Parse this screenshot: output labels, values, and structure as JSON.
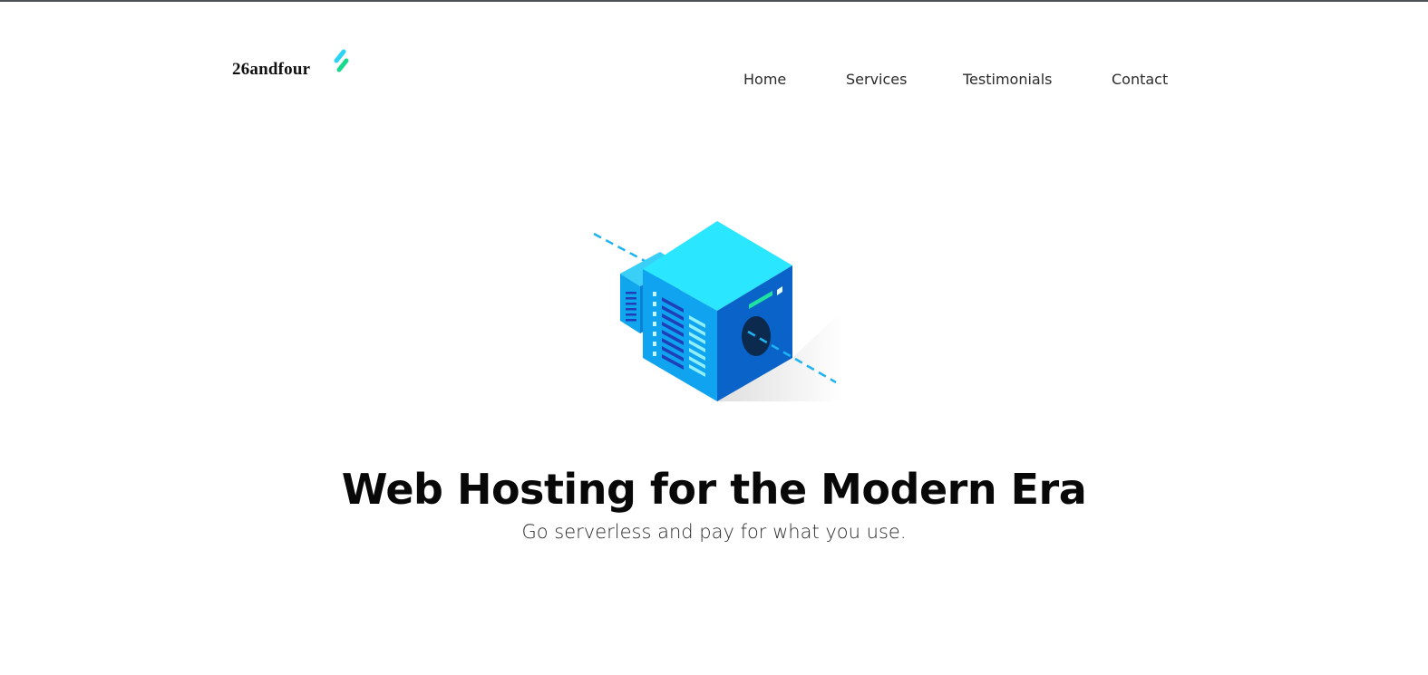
{
  "brand": {
    "name": "26andfour",
    "logo_icon": "lightning-stripes-icon",
    "logo_colors": [
      "#2ad4f6",
      "#18d98e"
    ]
  },
  "nav": {
    "items": [
      {
        "label": "Home"
      },
      {
        "label": "Services"
      },
      {
        "label": "Testimonials"
      },
      {
        "label": "Contact"
      }
    ]
  },
  "hero": {
    "illustration": "isometric-server-cube-icon",
    "title": "Web Hosting for the Modern Era",
    "subtitle": "Go serverless and pay for what you use."
  },
  "colors": {
    "cube_top": "#2ae6ff",
    "cube_right": "#0a63c9",
    "cube_left": "#0fa3f0",
    "accent_green": "#1fe3a0",
    "dash_line": "#1fb3f0",
    "top_border": "#4d5355"
  }
}
